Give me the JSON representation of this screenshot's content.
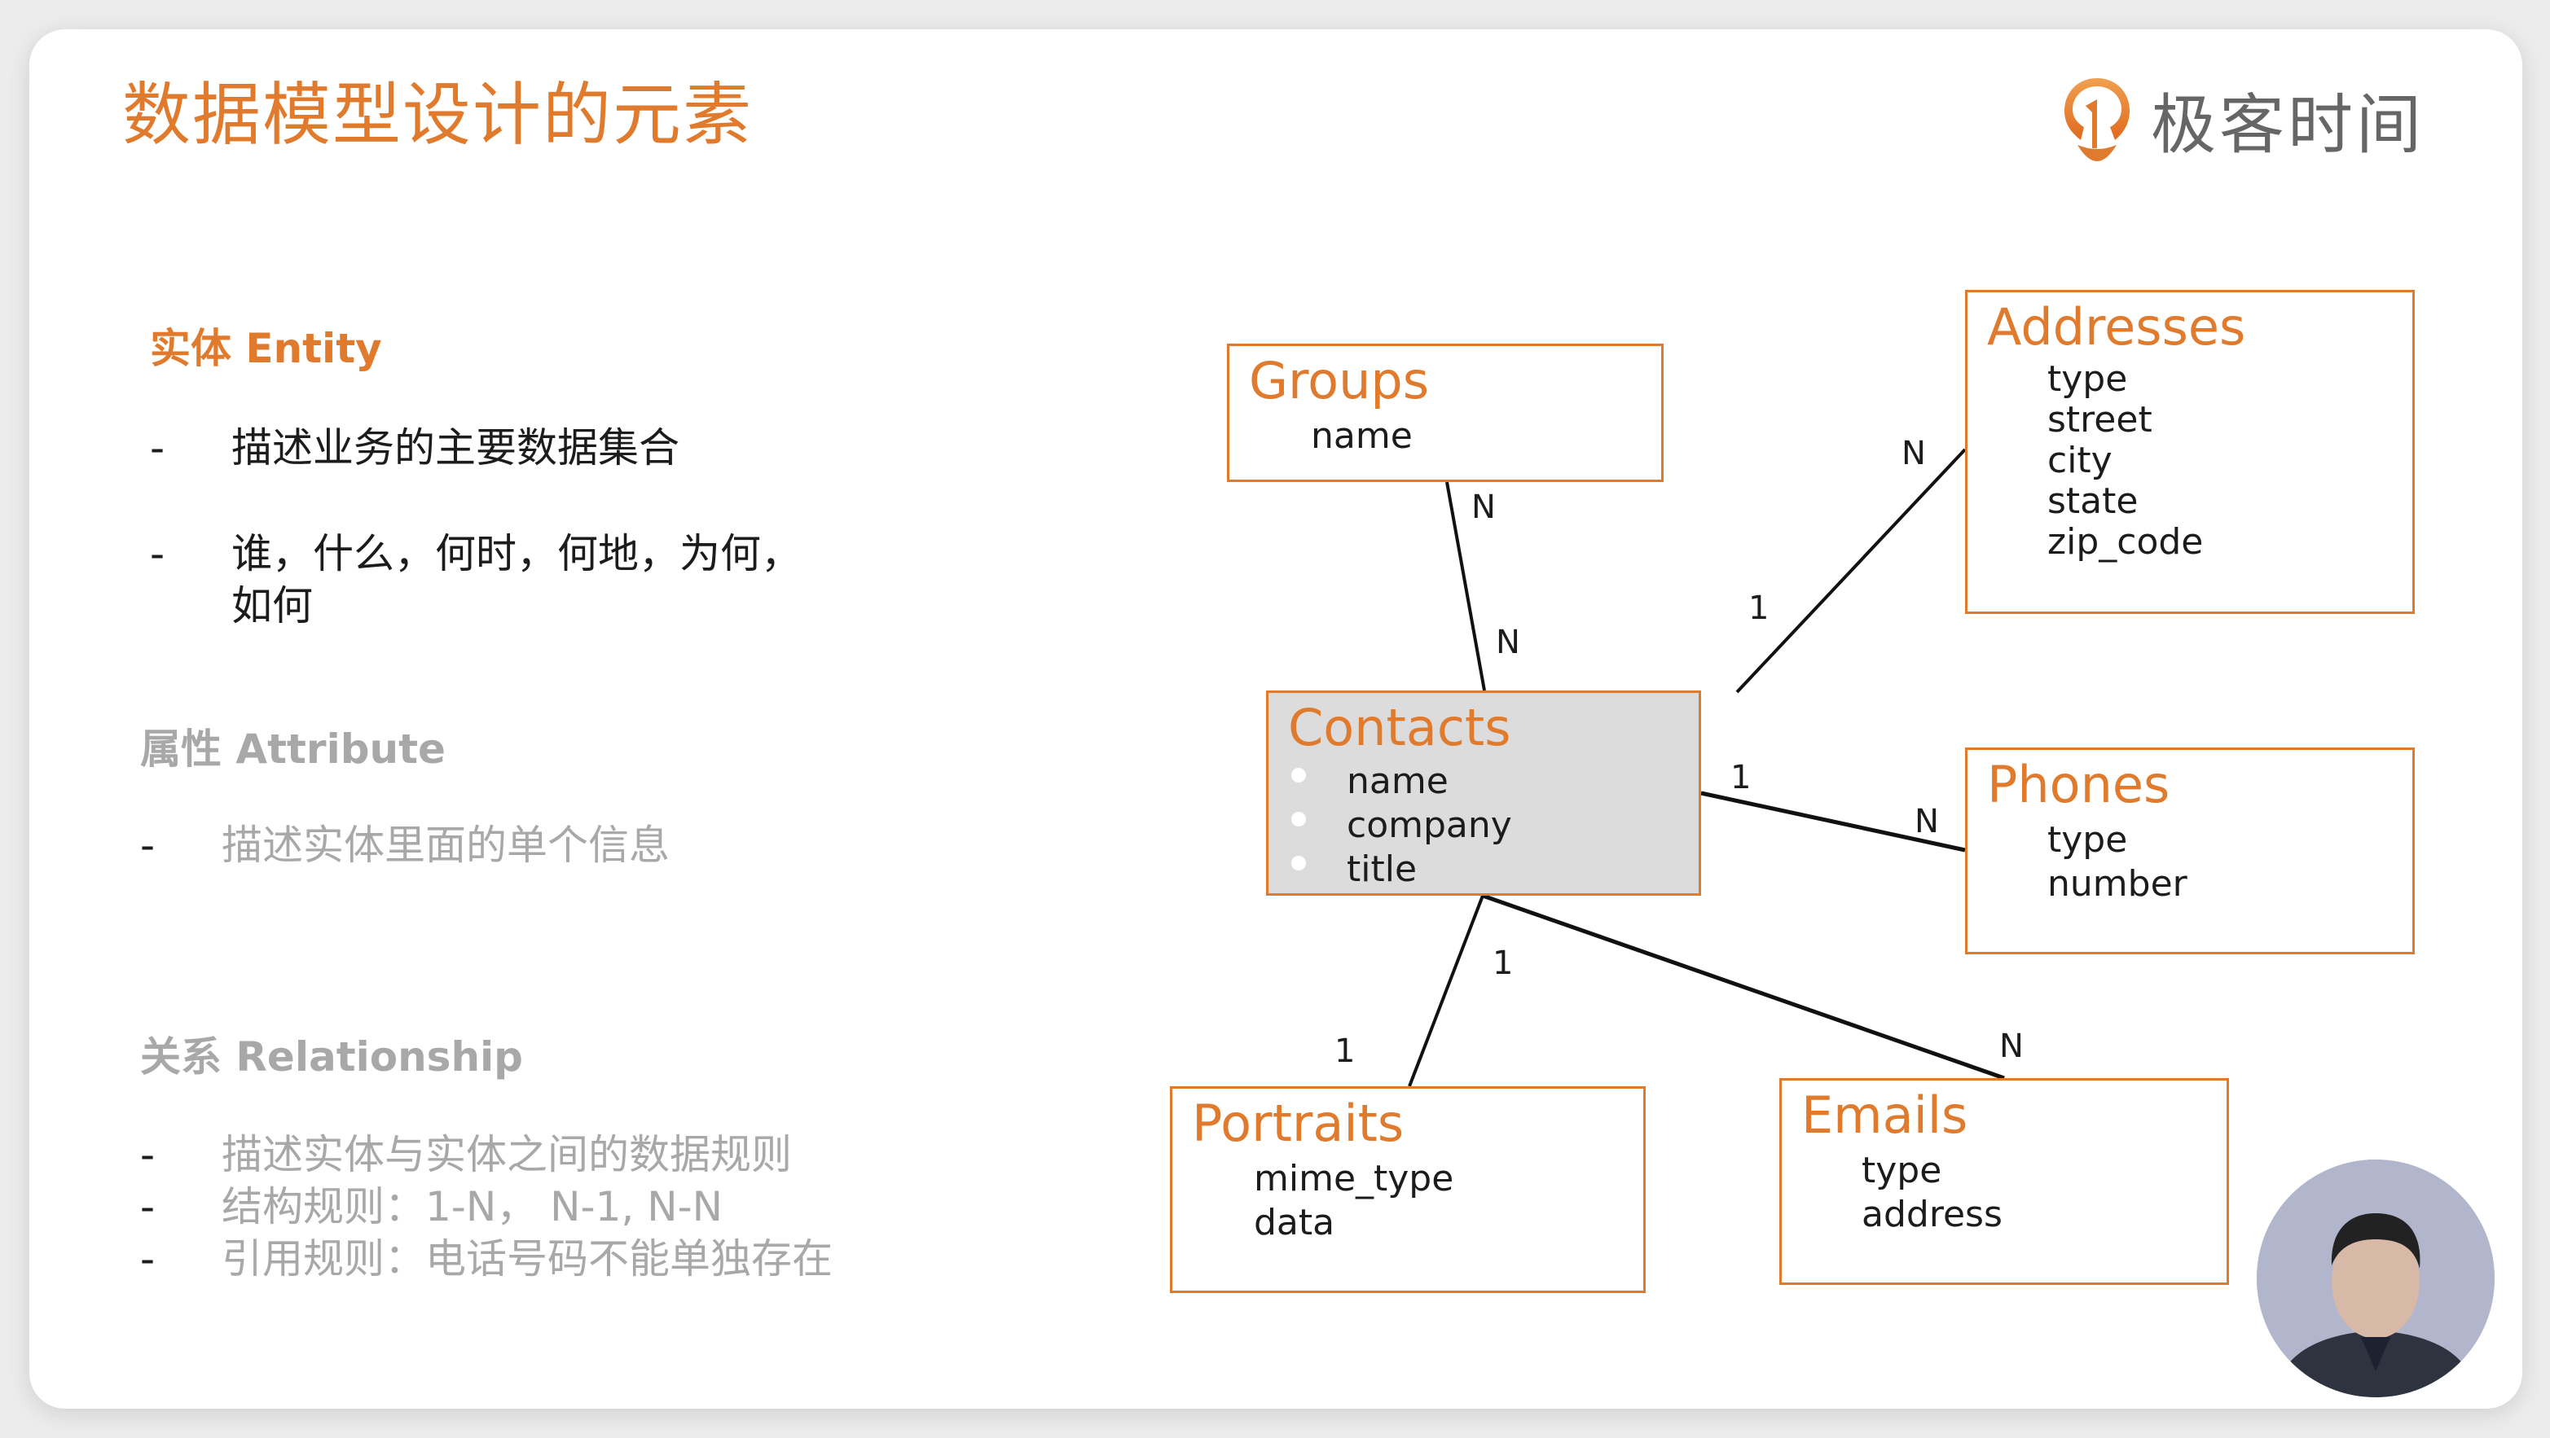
{
  "slide": {
    "title": "数据模型设计的元素",
    "brand": {
      "name": "极客时间",
      "logo_icon": "geektime-logo-icon",
      "accent": "#e07b2e"
    }
  },
  "sections": [
    {
      "heading": "实体 Entity",
      "color": "#e07b2e",
      "bullets": [
        {
          "dash": "-",
          "text": "描述业务的主要数据集合"
        },
        {
          "dash": "-",
          "text": "谁，什么，何时，何地，为何，",
          "text2": "如何"
        }
      ]
    },
    {
      "heading": "属性 Attribute",
      "color": "#a8a8a8",
      "bullets": [
        {
          "dash": "-",
          "text": "描述实体里面的单个信息"
        }
      ]
    },
    {
      "heading": "关系 Relationship",
      "color": "#a8a8a8",
      "bullets": [
        {
          "dash": "-",
          "text": "描述实体与实体之间的数据规则"
        },
        {
          "dash": "-",
          "text": "结构规则：1-N，  N-1, N-N"
        },
        {
          "dash": "-",
          "text": "引用规则：电话号码不能单独存在"
        }
      ]
    }
  ],
  "diagram": {
    "entities": {
      "groups": {
        "name": "Groups",
        "attributes": [
          "name"
        ]
      },
      "addresses": {
        "name": "Addresses",
        "attributes": [
          "type",
          "street",
          "city",
          "state",
          "zip_code"
        ]
      },
      "contacts": {
        "name": "Contacts",
        "attributes": [
          "name",
          "company",
          "title"
        ],
        "highlighted": true
      },
      "phones": {
        "name": "Phones",
        "attributes": [
          "type",
          "number"
        ]
      },
      "portraits": {
        "name": "Portraits",
        "attributes": [
          "mime_type",
          "data"
        ]
      },
      "emails": {
        "name": "Emails",
        "attributes": [
          "type",
          "address"
        ]
      }
    },
    "relationships": [
      {
        "from": "Groups",
        "to": "Contacts",
        "from_card": "N",
        "to_card": "N"
      },
      {
        "from": "Contacts",
        "to": "Addresses",
        "from_card": "1",
        "to_card": "N"
      },
      {
        "from": "Contacts",
        "to": "Phones",
        "from_card": "1",
        "to_card": "N"
      },
      {
        "from": "Contacts",
        "to": "Portraits",
        "from_card": "1",
        "to_card": "1"
      },
      {
        "from": "Contacts",
        "to": "Emails",
        "from_card": "1",
        "to_card": "N"
      }
    ]
  },
  "presenter": {
    "video_label": "presenter-video"
  }
}
